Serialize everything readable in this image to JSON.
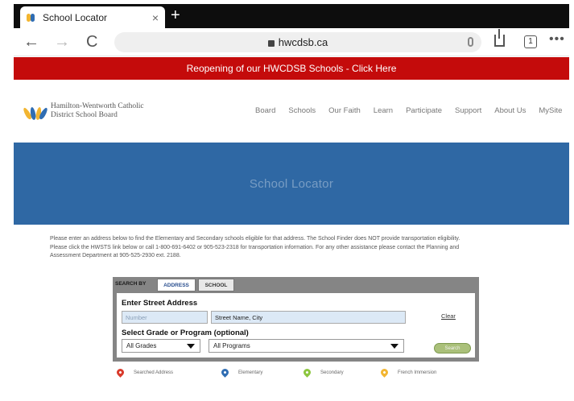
{
  "browser": {
    "tab_title": "School Locator",
    "close_glyph": "×",
    "new_tab_glyph": "+",
    "url": "hwcdsb.ca",
    "back_glyph": "←",
    "forward_glyph": "→",
    "reload_glyph": "C",
    "tabs_count": "1",
    "more_glyph": "•••"
  },
  "announcement": "Reopening of our HWCDSB Schools - Click Here",
  "header": {
    "logo_line1": "Hamilton-Wentworth Catholic",
    "logo_line2": "District School Board",
    "nav": [
      "Board",
      "Schools",
      "Our Faith",
      "Learn",
      "Participate",
      "Support",
      "About Us",
      "MySite"
    ]
  },
  "hero": {
    "title": "School Locator"
  },
  "intro": {
    "line1": "Please enter an address below to find the Elementary and Secondary schools eligible for that address. The School Finder does NOT provide transportation eligibility.",
    "line2": "Please click the HWSTS link below or call 1-800-691-6402 or 905-523-2318 for transportation information. For any other assistance please contact the Planning and",
    "line3": "Assessment Department at 905-525-2930 ext. 2188."
  },
  "finder": {
    "search_by": "SEARCH BY",
    "tabs": [
      "ADDRESS",
      "SCHOOL"
    ],
    "address_heading": "Enter Street Address",
    "number_placeholder": "Number",
    "street_value": "Street Name, City",
    "grade_heading": "Select Grade or Program (optional)",
    "clear_label": "Clear",
    "grades_selected": "All Grades",
    "programs_selected": "All Programs",
    "search_label": "Search"
  },
  "legend": [
    {
      "label": "Searched Address",
      "color": "#d93a2b"
    },
    {
      "label": "Elementary",
      "color": "#2f6db3"
    },
    {
      "label": "Secondary",
      "color": "#8cc63f"
    },
    {
      "label": "French Immersion",
      "color": "#f2b531"
    }
  ],
  "colors": {
    "announcement_bg": "#c40b0b",
    "hero_bg": "#2f68a4",
    "active_tab_text": "#2a4f8f"
  }
}
